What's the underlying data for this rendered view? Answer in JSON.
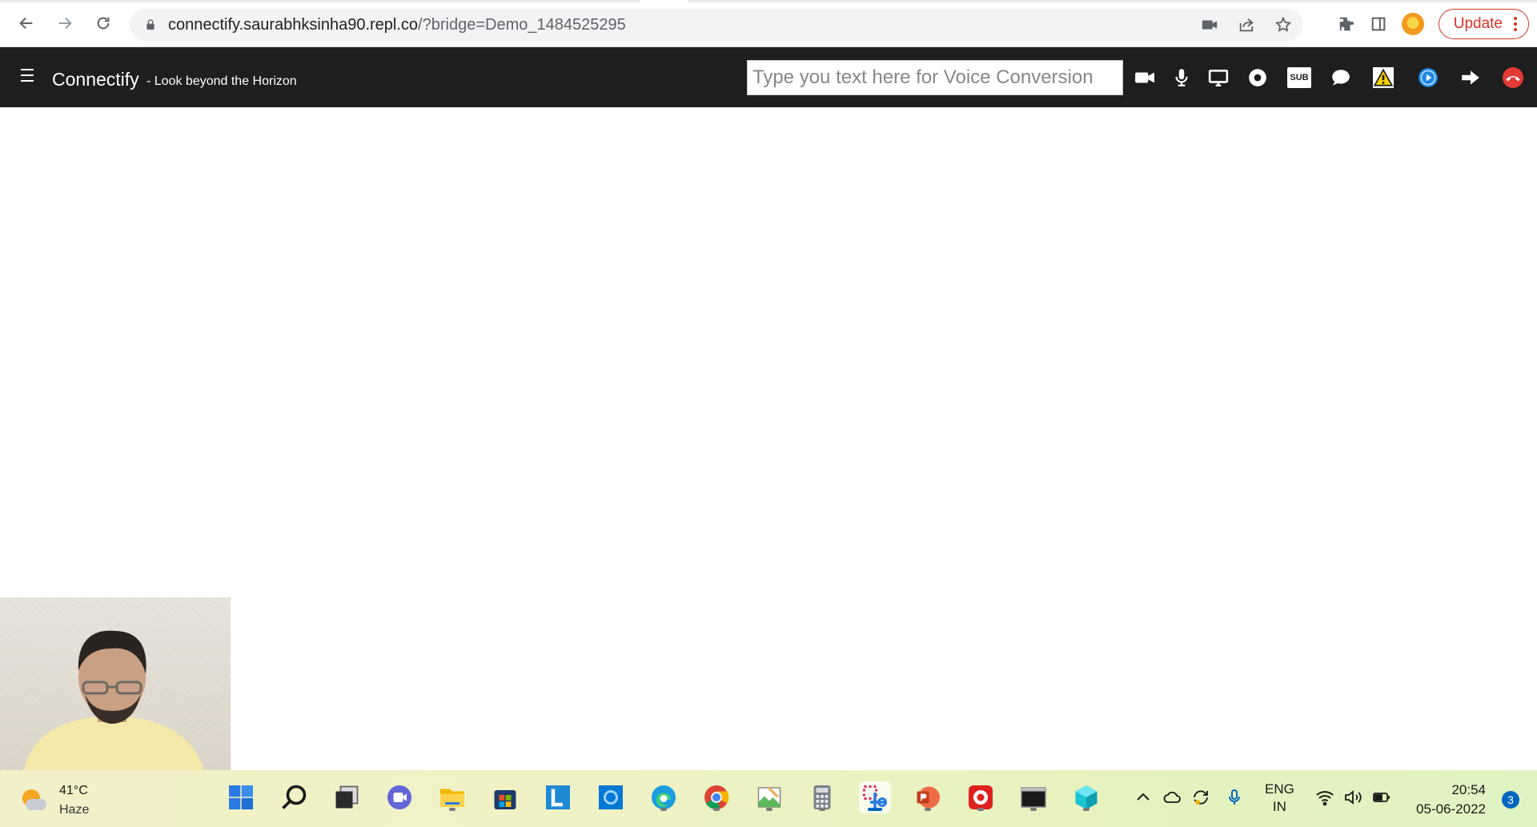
{
  "browser": {
    "url_host": "connectify.saurabhksinha90.repl.co",
    "url_rest": "/?bridge=Demo_1484525295",
    "update_label": "Update"
  },
  "app": {
    "brand": "Connectify",
    "tagline": "- Look beyond the Horizon",
    "voice_input_placeholder": "Type you text here for Voice Conversion",
    "voice_input_value": "",
    "toolbar_icons": [
      "video-camera-icon",
      "microphone-icon",
      "screen-share-icon",
      "record-icon",
      "subtitles-icon",
      "chat-icon",
      "warning-icon",
      "play-icon",
      "leave-icon",
      "hang-up-icon"
    ],
    "subtitles_badge": "SUB",
    "colors": {
      "header_bg": "#1e1e1e",
      "hangup": "#e53935",
      "warning": "#f5d000",
      "play": "#1e88e5"
    }
  },
  "taskbar": {
    "weather_temp": "41°C",
    "weather_desc": "Haze",
    "language_line1": "ENG",
    "language_line2": "IN",
    "time": "20:54",
    "date": "05-06-2022",
    "notification_count": "3"
  }
}
